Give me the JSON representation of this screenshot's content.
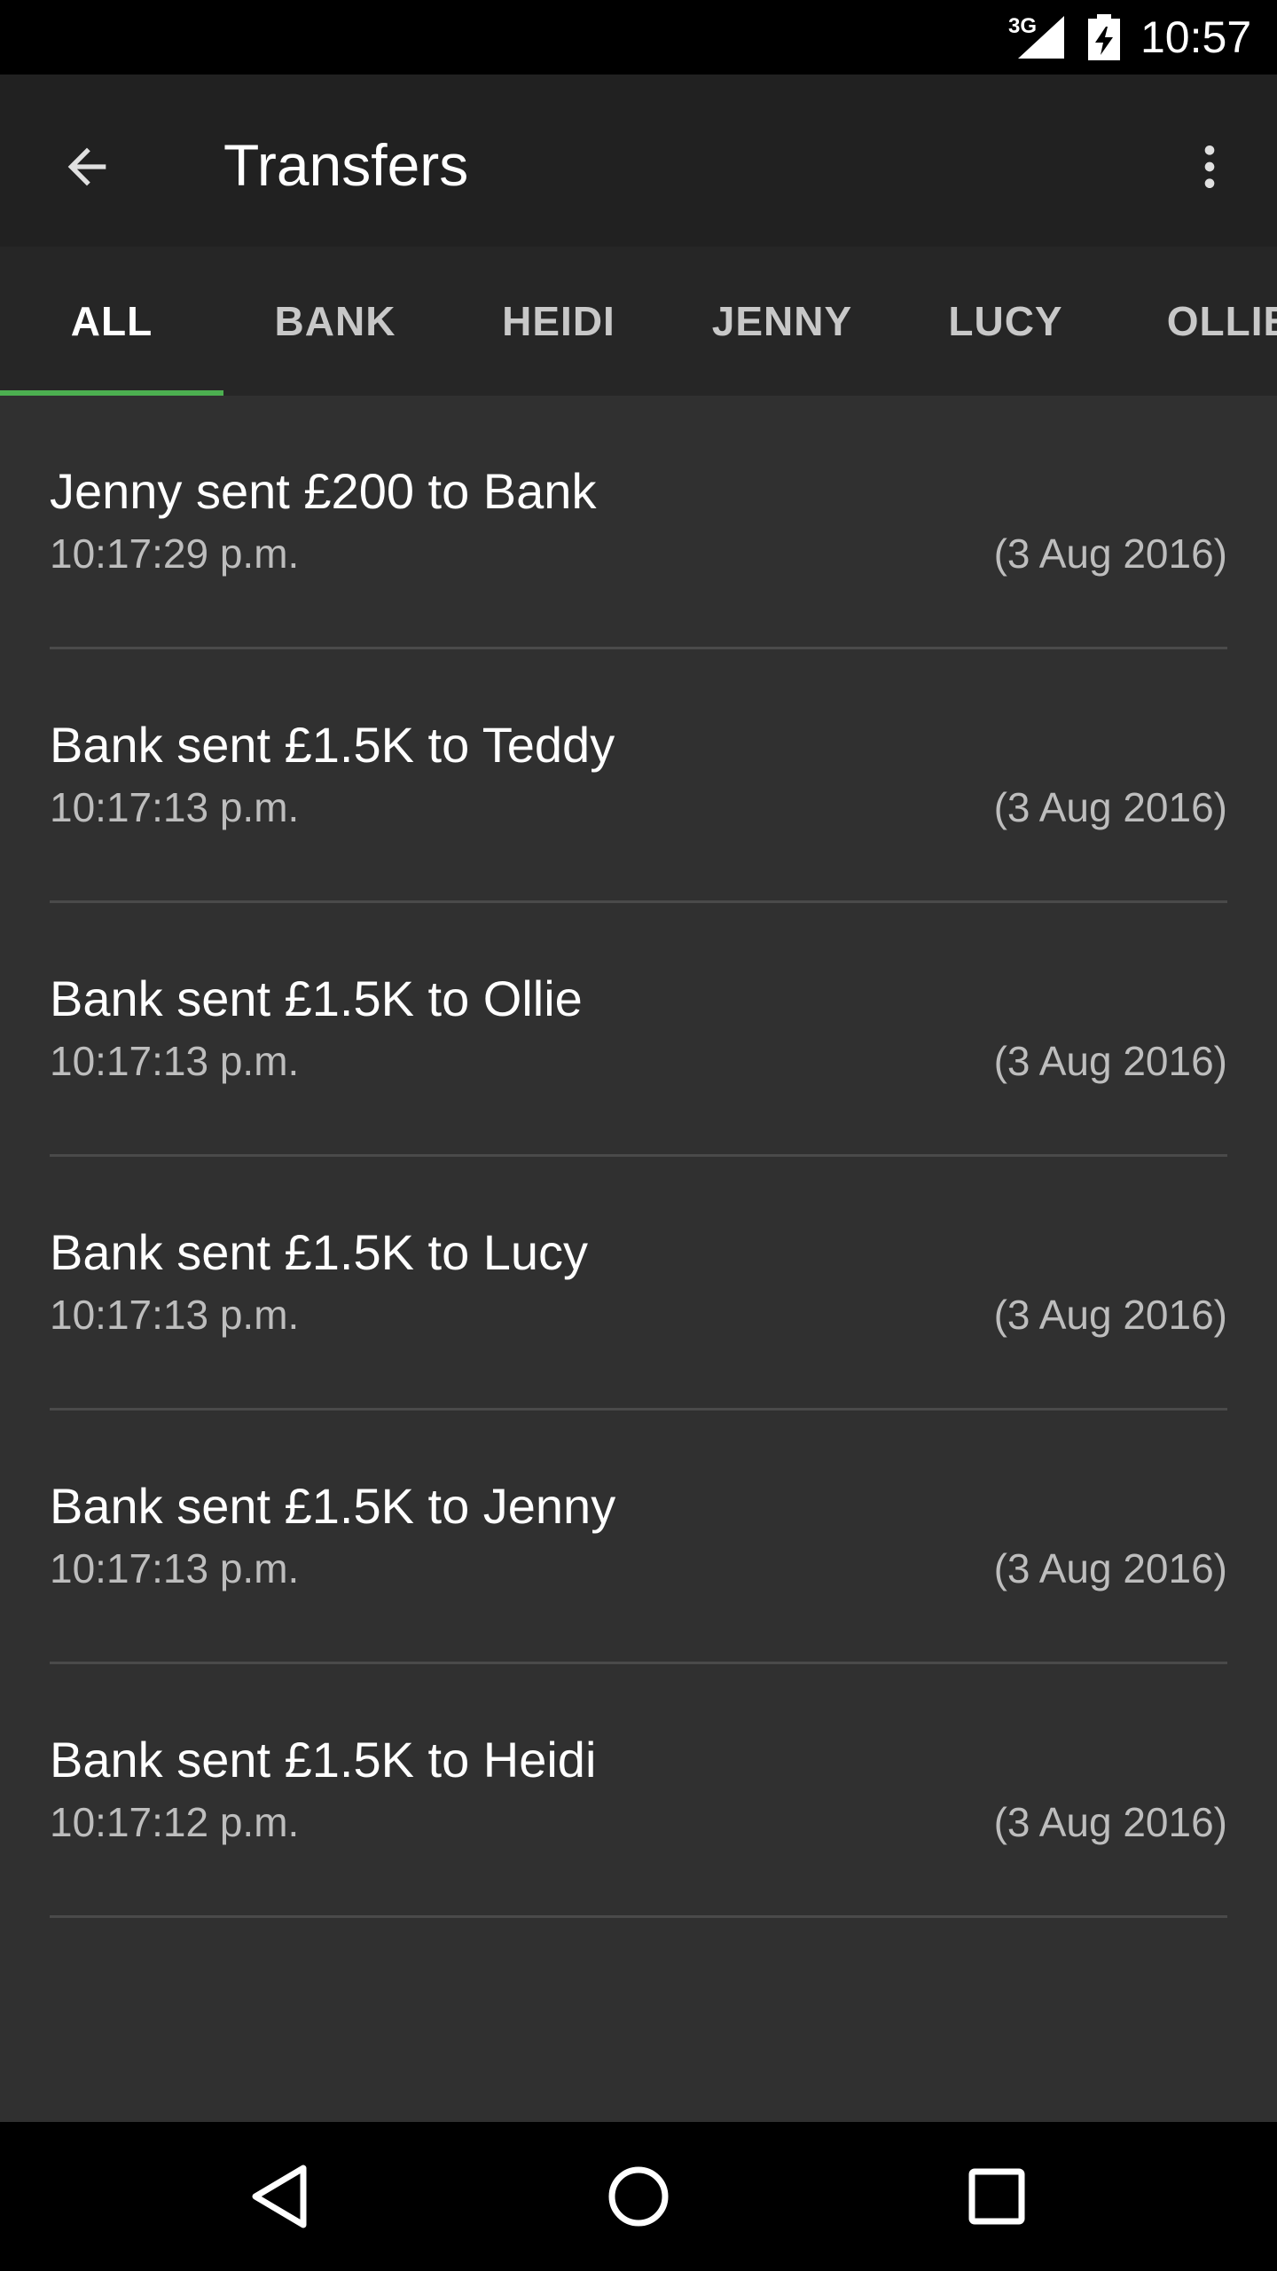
{
  "status_bar": {
    "network_type": "3G",
    "time": "10:57"
  },
  "app_bar": {
    "title": "Transfers",
    "back_icon": "arrow-back-icon",
    "menu_icon": "more-vert-icon"
  },
  "tabs": [
    {
      "label": "ALL",
      "active": true
    },
    {
      "label": "BANK",
      "active": false
    },
    {
      "label": "HEIDI",
      "active": false
    },
    {
      "label": "JENNY",
      "active": false
    },
    {
      "label": "LUCY",
      "active": false
    },
    {
      "label": "OLLIE",
      "active": false
    }
  ],
  "accent_color": "#4caf50",
  "transfers": [
    {
      "description": "Jenny sent £200 to Bank",
      "time": "10:17:29 p.m.",
      "date": "(3 Aug 2016)"
    },
    {
      "description": "Bank sent £1.5K to Teddy",
      "time": "10:17:13 p.m.",
      "date": "(3 Aug 2016)"
    },
    {
      "description": "Bank sent £1.5K to Ollie",
      "time": "10:17:13 p.m.",
      "date": "(3 Aug 2016)"
    },
    {
      "description": "Bank sent £1.5K to Lucy",
      "time": "10:17:13 p.m.",
      "date": "(3 Aug 2016)"
    },
    {
      "description": "Bank sent £1.5K to Jenny",
      "time": "10:17:13 p.m.",
      "date": "(3 Aug 2016)"
    },
    {
      "description": "Bank sent £1.5K to Heidi",
      "time": "10:17:12 p.m.",
      "date": "(3 Aug 2016)"
    }
  ],
  "nav_bar": {
    "back_icon": "nav-back-icon",
    "home_icon": "nav-home-icon",
    "recents_icon": "nav-recents-icon"
  }
}
